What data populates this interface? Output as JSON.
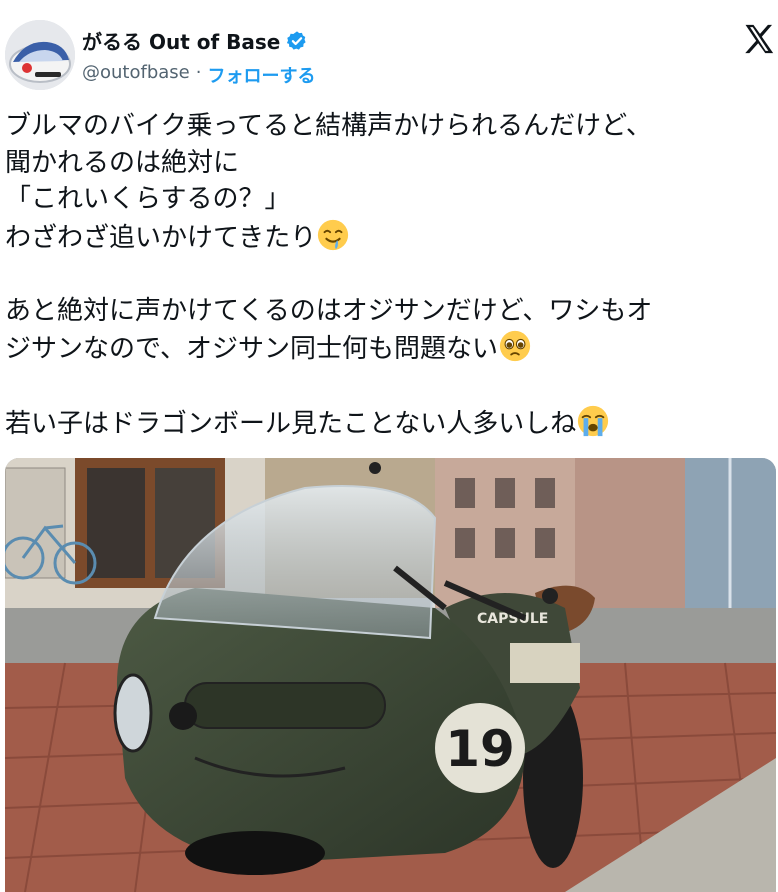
{
  "author": {
    "display_name": "がるる Out of Base",
    "handle": "@outofbase",
    "separator": "·",
    "follow_label": "フォローする"
  },
  "tweet": {
    "lines": [
      "ブルマのバイク乗ってると結構声かけられるんだけど、",
      "聞かれるのは絶対に",
      "「これいくらするの？」",
      "わざわざ追いかけてきたり",
      "",
      "あと絶対に声かけてくるのはオジサンだけど、ワシもオ",
      "ジサンなので、オジサン同士何も問題ない",
      "",
      "若い子はドラゴンボール見たことない人多いしね"
    ]
  },
  "media": {
    "bike_number": "19",
    "bike_badge": "CAPSULE"
  },
  "icons": {
    "verified": "verified-badge-icon",
    "platform": "x-logo-icon",
    "emoji_1": "drooling-face-emoji",
    "emoji_2": "pleading-face-emoji",
    "emoji_3": "loudly-crying-face-emoji"
  },
  "colors": {
    "link": "#1d9bf0",
    "secondary_text": "#536471",
    "verified": "#1d9bf0"
  }
}
